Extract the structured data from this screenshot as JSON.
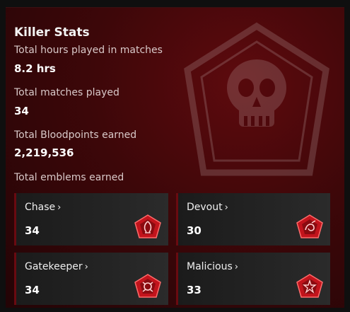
{
  "killer_stats": {
    "title": "Killer Stats",
    "stats": [
      {
        "label": "Total hours played in matches",
        "value": "8.2 hrs"
      },
      {
        "label": "Total matches played",
        "value": "34"
      },
      {
        "label": "Total Bloodpoints earned",
        "value": "2,219,536"
      }
    ],
    "emblems_label": "Total emblems earned",
    "emblems": [
      {
        "name": "Chase",
        "count": "34",
        "icon": "chase-emblem-icon"
      },
      {
        "name": "Devout",
        "count": "30",
        "icon": "devout-emblem-icon"
      },
      {
        "name": "Gatekeeper",
        "count": "34",
        "icon": "gatekeeper-emblem-icon"
      },
      {
        "name": "Malicious",
        "count": "33",
        "icon": "malicious-emblem-icon"
      }
    ],
    "chevron": "›",
    "colors": {
      "panel_red": "#3d0709",
      "emblem_red": "#c2141c",
      "card_bg": "#1f1f1f"
    }
  }
}
